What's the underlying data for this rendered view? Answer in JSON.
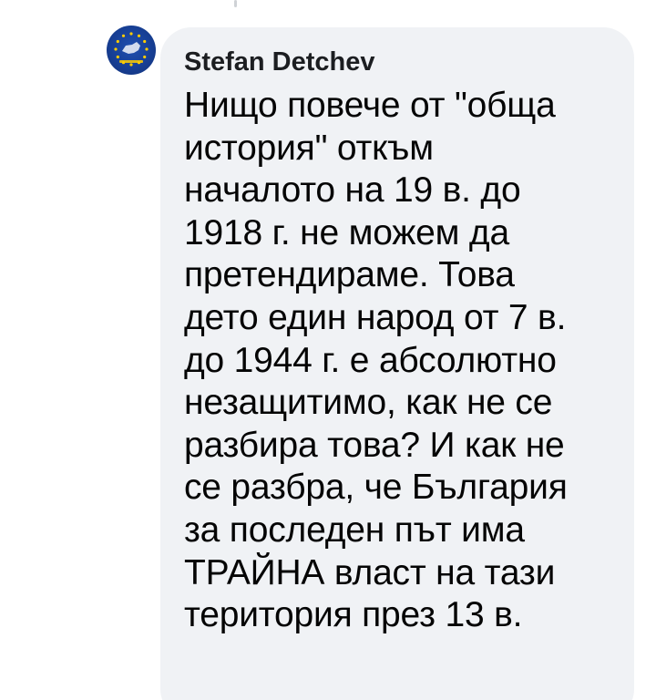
{
  "thread": {
    "comment": {
      "author": "Stefan Detchev",
      "avatar_icon": "eu-flag-avatar-icon",
      "text_lines": [
        "Нищо повече от \"обща",
        "история\" откъм",
        "началото на 19 в. до",
        "1918 г. не можем да",
        "претендираме. Това",
        "дето един народ от 7 в.",
        "до 1944 г. е абсолютно",
        "незащитимо, как не се",
        "разбира това? И как не",
        "се разбра, че България",
        "за последен път има",
        "ТРАЙНА власт на тази",
        "територия през 13 в."
      ]
    }
  },
  "colors": {
    "bubble_background": "#f0f2f5",
    "text": "#050505",
    "avatar_blue": "#173f95",
    "avatar_stars": "#ffcc00"
  }
}
